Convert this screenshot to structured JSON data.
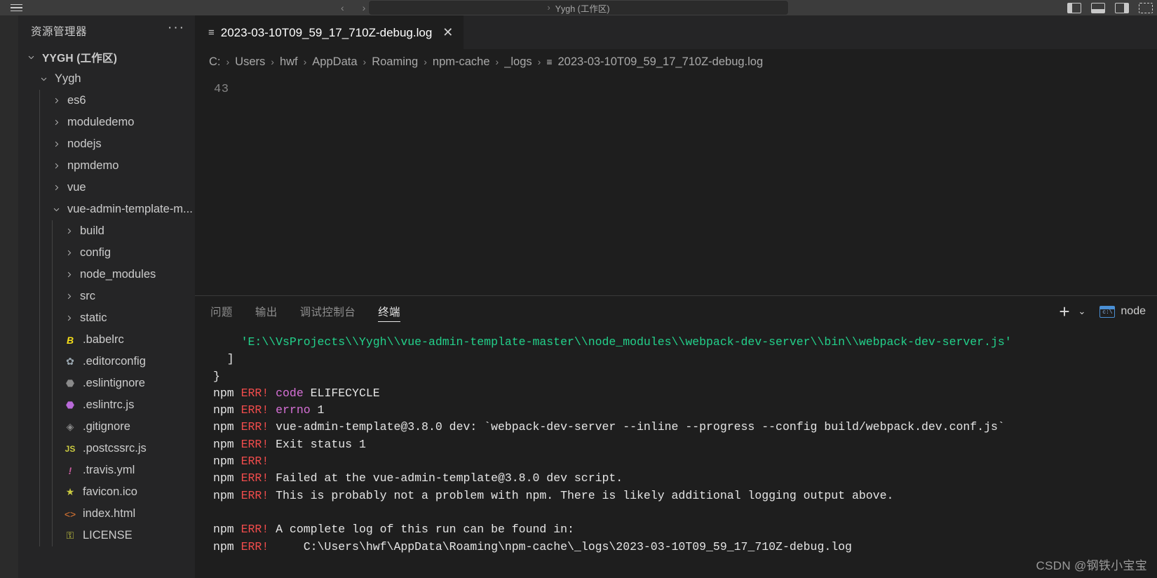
{
  "titlebar": {
    "menu_icon": "hamburger-icon",
    "nav_back": "‹",
    "nav_forward": "›",
    "search_sep": "›",
    "search_text": "Yygh (工作区)",
    "layout_icons": [
      "panel-left-icon",
      "panel-bottom-icon",
      "panel-right-icon",
      "customize-layout-icon"
    ]
  },
  "sidebar": {
    "title": "资源管理器",
    "more_actions": "···",
    "tree": [
      {
        "label": "YYGH (工作区)",
        "indent": 0,
        "type": "root",
        "expanded": true
      },
      {
        "label": "Yygh",
        "indent": 1,
        "type": "folder",
        "expanded": true
      },
      {
        "label": "es6",
        "indent": 2,
        "type": "folder",
        "expanded": false
      },
      {
        "label": "moduledemo",
        "indent": 2,
        "type": "folder",
        "expanded": false
      },
      {
        "label": "nodejs",
        "indent": 2,
        "type": "folder",
        "expanded": false
      },
      {
        "label": "npmdemo",
        "indent": 2,
        "type": "folder",
        "expanded": false
      },
      {
        "label": "vue",
        "indent": 2,
        "type": "folder",
        "expanded": false
      },
      {
        "label": "vue-admin-template-m...",
        "indent": 2,
        "type": "folder",
        "expanded": true
      },
      {
        "label": "build",
        "indent": 3,
        "type": "folder",
        "expanded": false
      },
      {
        "label": "config",
        "indent": 3,
        "type": "folder",
        "expanded": false
      },
      {
        "label": "node_modules",
        "indent": 3,
        "type": "folder",
        "expanded": false
      },
      {
        "label": "src",
        "indent": 3,
        "type": "folder",
        "expanded": false
      },
      {
        "label": "static",
        "indent": 3,
        "type": "folder",
        "expanded": false
      },
      {
        "label": ".babelrc",
        "indent": 3,
        "type": "file",
        "icon": "babel-icon",
        "glyph": "B",
        "color": "#f5de19"
      },
      {
        "label": ".editorconfig",
        "indent": 3,
        "type": "file",
        "icon": "gear-icon",
        "glyph": "✿",
        "color": "#9aa7b0"
      },
      {
        "label": ".eslintignore",
        "indent": 3,
        "type": "file",
        "icon": "eslint-ignore-icon",
        "glyph": "⬣",
        "color": "#8a8a8a"
      },
      {
        "label": ".eslintrc.js",
        "indent": 3,
        "type": "file",
        "icon": "eslint-icon",
        "glyph": "⬣",
        "color": "#b96ad9"
      },
      {
        "label": ".gitignore",
        "indent": 3,
        "type": "file",
        "icon": "git-ignore-icon",
        "glyph": "◈",
        "color": "#8a8a8a"
      },
      {
        "label": ".postcssrc.js",
        "indent": 3,
        "type": "file",
        "icon": "javascript-icon",
        "glyph": "JS",
        "color": "#cbcb41"
      },
      {
        "label": ".travis.yml",
        "indent": 3,
        "type": "file",
        "icon": "travis-icon",
        "glyph": "!",
        "color": "#c75d9e"
      },
      {
        "label": "favicon.ico",
        "indent": 3,
        "type": "file",
        "icon": "star-icon",
        "glyph": "★",
        "color": "#cbcb41"
      },
      {
        "label": "index.html",
        "indent": 3,
        "type": "file",
        "icon": "html-icon",
        "glyph": "<>",
        "color": "#e37933"
      },
      {
        "label": "LICENSE",
        "indent": 3,
        "type": "file",
        "icon": "license-key-icon",
        "glyph": "⚿",
        "color": "#cbcb41"
      }
    ]
  },
  "editor": {
    "tab": {
      "icon": "log-file-icon",
      "label": "2023-03-10T09_59_17_710Z-debug.log",
      "close": "✕"
    },
    "breadcrumb": {
      "separator": "›",
      "items": [
        "C:",
        "Users",
        "hwf",
        "AppData",
        "Roaming",
        "npm-cache",
        "_logs"
      ],
      "file_icon": "log-file-icon",
      "file": "2023-03-10T09_59_17_710Z-debug.log"
    },
    "line_number": "43"
  },
  "panel": {
    "tabs": [
      {
        "label": "问题",
        "active": false
      },
      {
        "label": "输出",
        "active": false
      },
      {
        "label": "调试控制台",
        "active": false
      },
      {
        "label": "终端",
        "active": true
      }
    ],
    "new_terminal": "+",
    "new_terminal_chevron": "⌄",
    "terminal_icon": "cmd-icon",
    "terminal_icon_label": "c:\\",
    "terminal_name": "node",
    "terminal_lines": [
      [
        {
          "t": "    ",
          "c": "w"
        },
        {
          "t": "'E:\\\\VsProjects\\\\Yygh\\\\vue-admin-template-master\\\\node_modules\\\\webpack-dev-server\\\\bin\\\\webpack-dev-server.js'",
          "c": "g"
        }
      ],
      [
        {
          "t": "  ]",
          "c": "w"
        }
      ],
      [
        {
          "t": "}",
          "c": "w"
        }
      ],
      [
        {
          "t": "npm ",
          "c": "w"
        },
        {
          "t": "ERR! ",
          "c": "r"
        },
        {
          "t": "code ",
          "c": "m"
        },
        {
          "t": "ELIFECYCLE",
          "c": "w"
        }
      ],
      [
        {
          "t": "npm ",
          "c": "w"
        },
        {
          "t": "ERR! ",
          "c": "r"
        },
        {
          "t": "errno ",
          "c": "m"
        },
        {
          "t": "1",
          "c": "w"
        }
      ],
      [
        {
          "t": "npm ",
          "c": "w"
        },
        {
          "t": "ERR! ",
          "c": "r"
        },
        {
          "t": "vue-admin-template@3.8.0 dev: `webpack-dev-server --inline --progress --config build/webpack.dev.conf.js`",
          "c": "w"
        }
      ],
      [
        {
          "t": "npm ",
          "c": "w"
        },
        {
          "t": "ERR! ",
          "c": "r"
        },
        {
          "t": "Exit status 1",
          "c": "w"
        }
      ],
      [
        {
          "t": "npm ",
          "c": "w"
        },
        {
          "t": "ERR!",
          "c": "r"
        }
      ],
      [
        {
          "t": "npm ",
          "c": "w"
        },
        {
          "t": "ERR! ",
          "c": "r"
        },
        {
          "t": "Failed at the vue-admin-template@3.8.0 dev script.",
          "c": "w"
        }
      ],
      [
        {
          "t": "npm ",
          "c": "w"
        },
        {
          "t": "ERR! ",
          "c": "r"
        },
        {
          "t": "This is probably not a problem with npm. There is likely additional logging output above.",
          "c": "w"
        }
      ],
      [
        {
          "t": "",
          "c": "w"
        }
      ],
      [
        {
          "t": "npm ",
          "c": "w"
        },
        {
          "t": "ERR! ",
          "c": "r"
        },
        {
          "t": "A complete log of this run can be found in:",
          "c": "w"
        }
      ],
      [
        {
          "t": "npm ",
          "c": "w"
        },
        {
          "t": "ERR! ",
          "c": "r"
        },
        {
          "t": "    C:\\Users\\hwf\\AppData\\Roaming\\npm-cache\\_logs\\2023-03-10T09_59_17_710Z-debug.log",
          "c": "w"
        }
      ]
    ]
  },
  "watermark": "CSDN @钢铁小宝宝",
  "colors": {
    "background": "#1e1e1e",
    "sidebar_background": "#252526",
    "titlebar_background": "#3c3c3c",
    "accent_error": "#f14c4c",
    "accent_string": "#23d18b",
    "accent_key": "#d670d6"
  }
}
